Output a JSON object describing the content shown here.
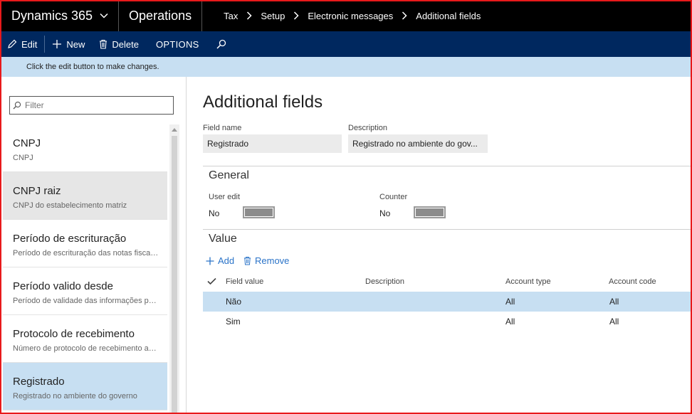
{
  "nav": {
    "brand": "Dynamics 365",
    "module": "Operations",
    "breadcrumbs": [
      "Tax",
      "Setup",
      "Electronic messages",
      "Additional fields"
    ]
  },
  "toolbar": {
    "edit": "Edit",
    "new": "New",
    "delete": "Delete",
    "options": "OPTIONS"
  },
  "infobar": {
    "message": "Click the edit button to make changes."
  },
  "filter": {
    "placeholder": "Filter"
  },
  "list": {
    "items": [
      {
        "title": "CNPJ",
        "subtitle": "CNPJ"
      },
      {
        "title": "CNPJ raiz",
        "subtitle": "CNPJ do estabelecimento matriz"
      },
      {
        "title": "Período de escrituração",
        "subtitle": "Período de escrituração das notas fiscais de serviço"
      },
      {
        "title": "Período valido desde",
        "subtitle": "Período de validade das informações prestadas"
      },
      {
        "title": "Protocolo de recebimento",
        "subtitle": "Número de protocolo de recebimento assinado"
      },
      {
        "title": "Registrado",
        "subtitle": "Registrado no ambiente do governo"
      }
    ],
    "selected_index": 5
  },
  "detail": {
    "title": "Additional fields",
    "field_name_label": "Field name",
    "field_name_value": "Registrado",
    "description_label": "Description",
    "description_value": "Registrado no ambiente do gov...",
    "general": {
      "title": "General",
      "user_edit_label": "User edit",
      "user_edit_value": "No",
      "counter_label": "Counter",
      "counter_value": "No"
    },
    "value": {
      "title": "Value",
      "add_label": "Add",
      "remove_label": "Remove",
      "columns": [
        "Field value",
        "Description",
        "Account type",
        "Account code"
      ],
      "rows": [
        {
          "field_value": "Não",
          "description": "",
          "account_type": "All",
          "account_code": "All",
          "selected": true
        },
        {
          "field_value": "Sim",
          "description": "",
          "account_type": "All",
          "account_code": "All",
          "selected": false
        }
      ]
    }
  },
  "colors": {
    "nav_bg": "#000000",
    "actionbar_bg": "#00285f",
    "infobar_bg": "#c7dff2",
    "selection": "#c7dff2",
    "link": "#2a73c8",
    "frame": "#e8191b"
  }
}
